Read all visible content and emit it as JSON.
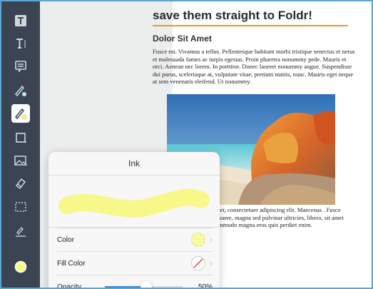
{
  "colors": {
    "accent": "#5aa7cf",
    "toolbar": "#3a4452",
    "highlight": "#f7f78a",
    "heading_rule": "#f0932b",
    "slider_fill": "#3d86d6"
  },
  "toolbar": {
    "items": [
      {
        "name": "text-box-icon"
      },
      {
        "name": "text-cursor-icon"
      },
      {
        "name": "note-icon"
      },
      {
        "name": "pen-icon"
      },
      {
        "name": "highlighter-icon",
        "active": true
      },
      {
        "name": "shape-icon"
      },
      {
        "name": "image-icon"
      },
      {
        "name": "eraser-icon"
      },
      {
        "name": "selection-icon"
      },
      {
        "name": "signature-icon"
      },
      {
        "name": "current-color-icon"
      }
    ]
  },
  "document": {
    "heading": "save them straight to Foldr!",
    "subheading": "Dolor Sit Amet",
    "paragraph1": "Fusce est. Vivamus a tellus. Pellentesque habitant morbi tristique senectus et netus et malesuada fames ac turpis egestas. Proin pharetra nonummy pede. Mauris et orci. Aenean nec lorem. In porttitor. Donec laoreet nonummy augue. Suspendisse dui purus, scelerisque at, vulputate vitae, pretium mattis, nunc. Mauris eget neque at sem venenatis eleifend. Ut nonummy.",
    "paragraph2": "amet, consectetuer adipiscing elit. Maecenas . Fusce posuere, magna sed pulvinar ultricies, libero, sit amet commodo magna eros quis perdiet enim."
  },
  "ink_popup": {
    "title": "Ink",
    "color_label": "Color",
    "fill_color_label": "Fill Color",
    "opacity_label": "Opacity",
    "opacity_value": "50%",
    "opacity_fraction": 0.5
  }
}
